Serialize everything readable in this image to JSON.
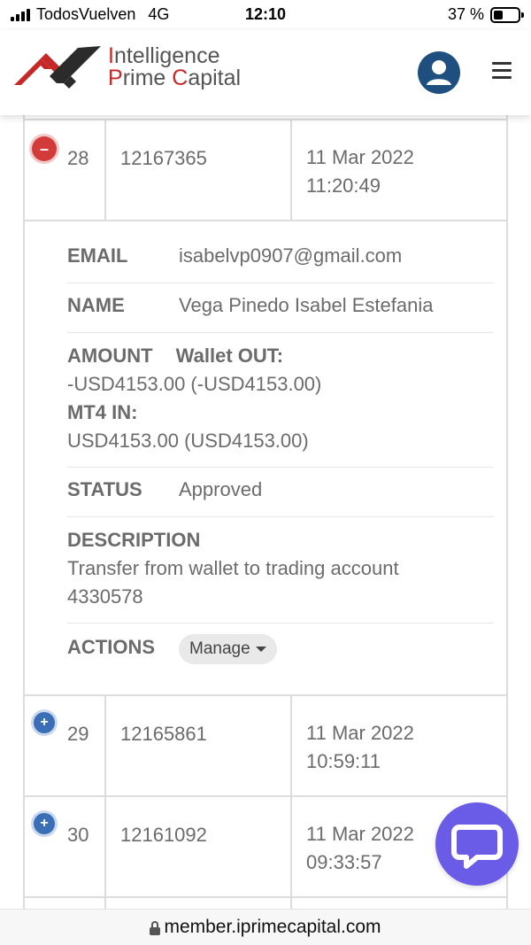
{
  "status_bar": {
    "carrier": "TodosVuelven",
    "network": "4G",
    "time": "12:10",
    "battery": "37 %"
  },
  "header": {
    "logo_line1": "Intelligence",
    "logo_line2_a": "P",
    "logo_line2_b": "rime ",
    "logo_line2_c": "C",
    "logo_line2_d": "apital"
  },
  "table": {
    "rows": [
      {
        "num": "28",
        "id": "12167365",
        "date": "11 Mar 2022",
        "time": "11:20:49",
        "expanded": true
      },
      {
        "num": "29",
        "id": "12165861",
        "date": "11 Mar 2022",
        "time": "10:59:11",
        "expanded": false
      },
      {
        "num": "30",
        "id": "12161092",
        "date": "11 Mar 2022",
        "time": "09:33:57",
        "expanded": false
      }
    ]
  },
  "detail": {
    "email_label": "EMAIL",
    "email_value": "isabelvp0907@gmail.com",
    "name_label": "NAME",
    "name_value": "Vega Pinedo Isabel Estefania",
    "amount_label": "AMOUNT",
    "wallet_out_label": "Wallet OUT:",
    "wallet_out_value": "-USD4153.00 (-USD4153.00)",
    "mt4_in_label": "MT4 IN:",
    "mt4_in_value": "USD4153.00 (USD4153.00)",
    "status_label": "STATUS",
    "status_value": "Approved",
    "description_label": "DESCRIPTION",
    "description_line1": "Transfer from wallet to trading account",
    "description_line2": "4330578",
    "actions_label": "ACTIONS",
    "manage_label": "Manage"
  },
  "url_bar": {
    "url": "member.iprimecapital.com"
  },
  "colors": {
    "accent_red": "#c62828",
    "toggle_minus": "#d33b3b",
    "toggle_plus": "#3a6fb5",
    "chat_purple": "#6a5ce6",
    "avatar_blue": "#1f4f7e"
  },
  "icons": {
    "signal": "signal-bars-icon",
    "battery": "battery-icon",
    "avatar": "user-avatar-icon",
    "menu": "hamburger-menu-icon",
    "chat": "chat-bubble-icon",
    "lock": "lock-icon",
    "collapse": "minus-circle-icon",
    "expand": "plus-circle-icon"
  }
}
